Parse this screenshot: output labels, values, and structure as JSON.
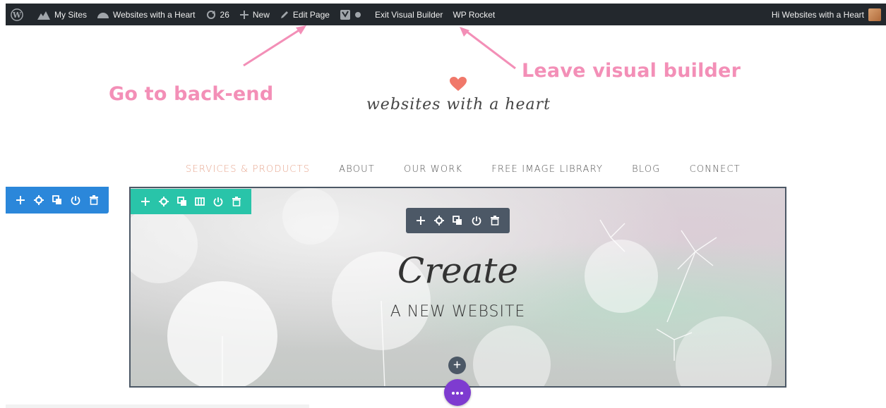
{
  "admin_bar": {
    "my_sites": "My Sites",
    "site_name": "Websites with a Heart",
    "updates_count": "26",
    "new_label": "New",
    "edit_page": "Edit Page",
    "exit_builder": "Exit Visual Builder",
    "wp_rocket": "WP Rocket",
    "greeting": "Hi Websites with a Heart"
  },
  "annotations": {
    "back_end": "Go to back-end",
    "leave_builder": "Leave visual builder",
    "color": "#f38fb7"
  },
  "logo": {
    "text": "websites with a heart",
    "heart_color": "#f0786a"
  },
  "nav": {
    "items": [
      "SERVICES & PRODUCTS",
      "ABOUT",
      "OUR WORK",
      "FREE IMAGE LIBRARY",
      "BLOG",
      "CONNECT"
    ],
    "active_color": "#e7a58e"
  },
  "hero": {
    "script_text": "Create",
    "subtitle": "A NEW WEBSITE"
  },
  "colors": {
    "admin_bar": "#23282d",
    "section_toolbar": "#2b87da",
    "row_toolbar": "#29c4a9",
    "module_toolbar": "#4c5866",
    "more_button": "#7e3bd0"
  },
  "icons": {
    "section_toolbar": [
      "move-icon",
      "settings-icon",
      "duplicate-icon",
      "save-to-library-icon",
      "delete-icon"
    ],
    "row_toolbar": [
      "move-icon",
      "settings-icon",
      "duplicate-icon",
      "columns-icon",
      "save-to-library-icon",
      "delete-icon"
    ],
    "module_toolbar": [
      "move-icon",
      "settings-icon",
      "duplicate-icon",
      "save-to-library-icon",
      "delete-icon"
    ]
  }
}
